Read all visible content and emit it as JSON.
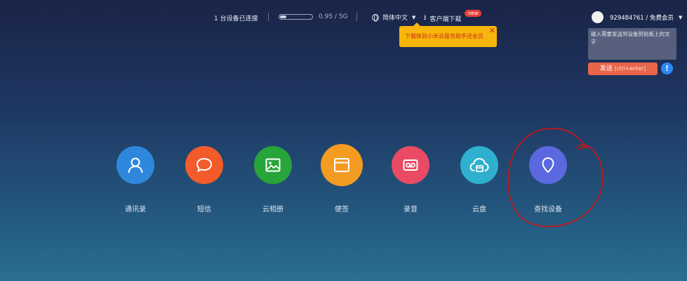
{
  "topbar": {
    "devices_text": "1 台设备已连接",
    "storage_text": "0.95 / 5G",
    "storage_used_fraction": 0.19,
    "language_label": "简体中文",
    "download_label": "客户端下载",
    "new_badge": "new",
    "tooltip_text": "下载体验小米云服务助手送会员",
    "user_label": "929484761 / 免费会员"
  },
  "clipboard": {
    "placeholder": "输入需要发送到设备剪贴板上的文字",
    "send_label": "发送",
    "send_hint": "[ctrl+enter]",
    "info_symbol": "!"
  },
  "apps": [
    {
      "label": "通讯录",
      "color": "#2f87dd",
      "icon": "contacts-icon"
    },
    {
      "label": "短信",
      "color": "#f25b2a",
      "icon": "message-icon"
    },
    {
      "label": "云相册",
      "color": "#27a43a",
      "icon": "photo-icon"
    },
    {
      "label": "便签",
      "color": "#f49b22",
      "icon": "notes-icon"
    },
    {
      "label": "录音",
      "color": "#e94a64",
      "icon": "recorder-icon"
    },
    {
      "label": "云盘",
      "color": "#2fb0cf",
      "icon": "cloud-drive-icon"
    },
    {
      "label": "查找设备",
      "color": "#5c68e0",
      "icon": "location-pin-icon"
    }
  ],
  "colors": {
    "annotation_circle": "#c0161b",
    "tooltip_bg": "#f8b60c"
  }
}
